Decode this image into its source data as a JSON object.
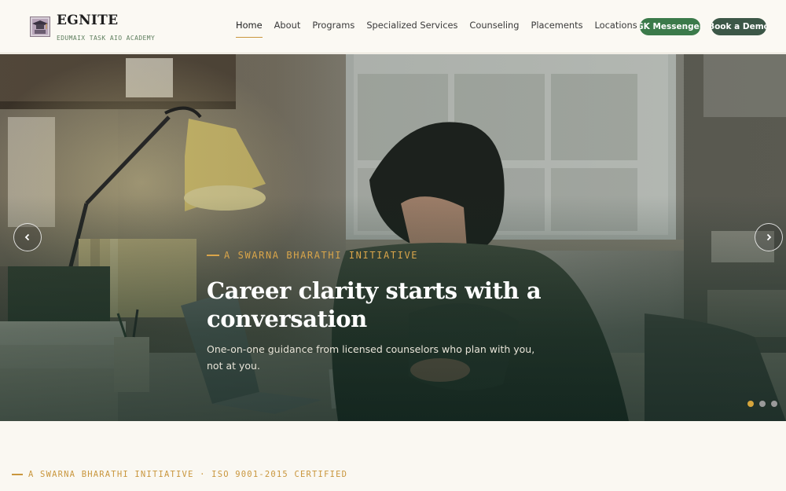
{
  "brand": {
    "name": "EGNITE",
    "tagline": "EDUMAIX TASK AIO ACADEMY"
  },
  "nav": {
    "items": [
      {
        "label": "Home",
        "active": true
      },
      {
        "label": "About"
      },
      {
        "label": "Programs"
      },
      {
        "label": "Specialized Services"
      },
      {
        "label": "Counseling"
      },
      {
        "label": "Placements"
      },
      {
        "label": "Locations"
      }
    ],
    "gk_button": "GK Messenger",
    "demo_button": "Book a Demo"
  },
  "hero": {
    "eyebrow": "A SWARNA BHARATHI INITIATIVE",
    "headline": "Career clarity starts with a conversation",
    "subtext": "One-on-one guidance from licensed counselors who plan with you, not at you.",
    "slide_count": 3,
    "active_slide": 1
  },
  "section": {
    "tag": "A SWARNA BHARATHI INITIATIVE · ISO 9001-2015 CERTIFIED"
  },
  "colors": {
    "accent": "#c9963d",
    "green_button": "#3b7a4a",
    "dark_green_button": "#3c5747",
    "background": "#faf8f2"
  },
  "icons": {
    "prev": "chevron-left-icon",
    "next": "chevron-right-icon",
    "logo": "graduation-logo-icon"
  }
}
